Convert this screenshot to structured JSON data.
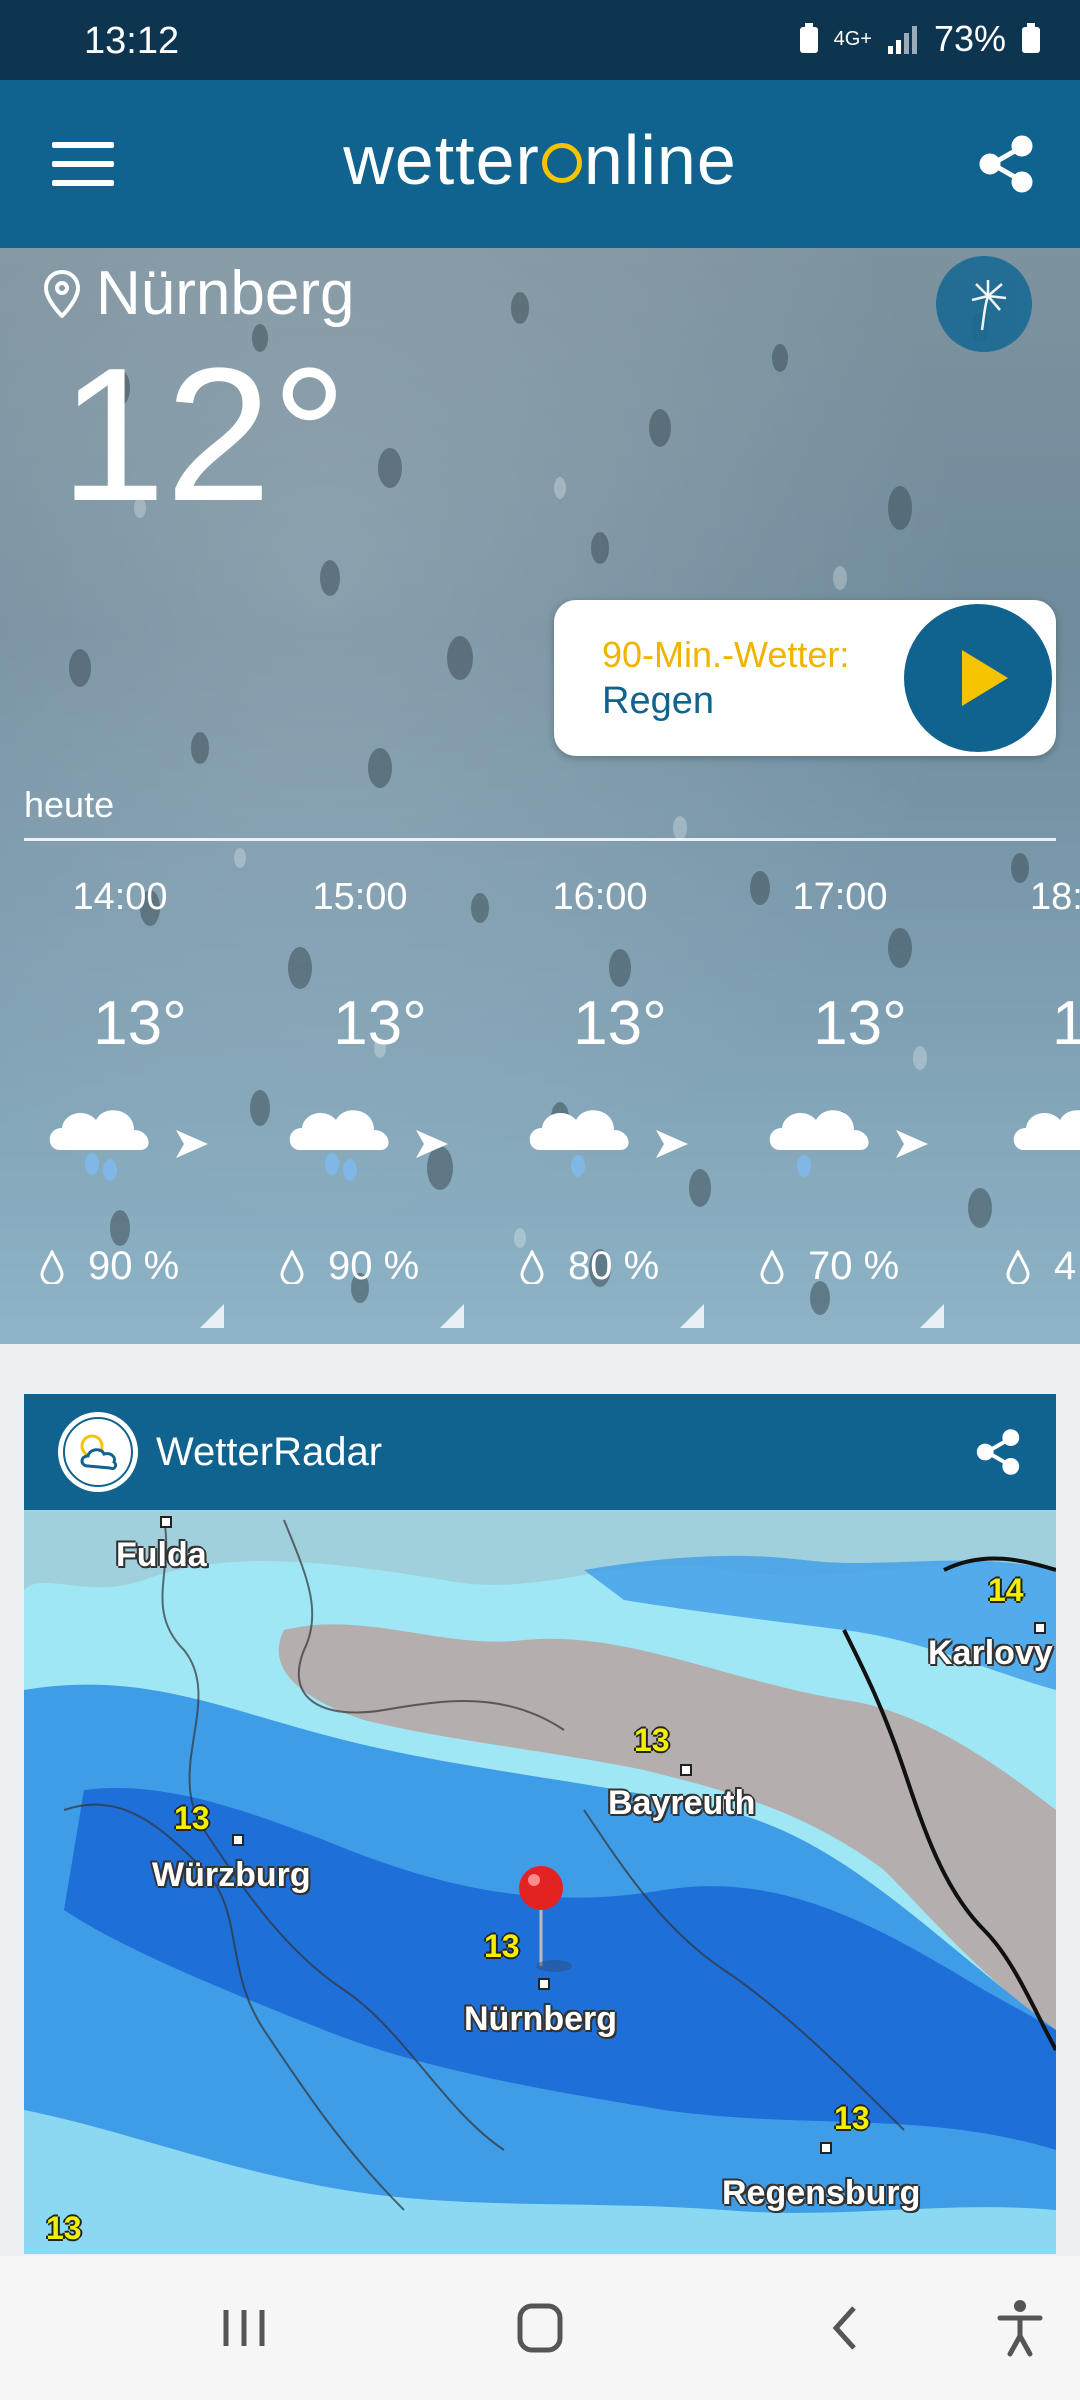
{
  "status": {
    "time": "13:12",
    "network": "4G+",
    "battery": "73%"
  },
  "header": {
    "logo_left": "wetter",
    "logo_right": "nline"
  },
  "location": {
    "name": "Nürnberg",
    "current_temp": "12°"
  },
  "nowcast": {
    "title": "90-Min.-Wetter:",
    "value": "Regen"
  },
  "forecast": {
    "day_label": "heute",
    "hours": [
      {
        "time": "14:00",
        "temp": "13°",
        "precip": "90 %",
        "icon": "cloud-heavy-rain-icon"
      },
      {
        "time": "15:00",
        "temp": "13°",
        "precip": "90 %",
        "icon": "cloud-heavy-rain-icon"
      },
      {
        "time": "16:00",
        "temp": "13°",
        "precip": "80 %",
        "icon": "cloud-rain-icon"
      },
      {
        "time": "17:00",
        "temp": "13°",
        "precip": "70 %",
        "icon": "cloud-rain-icon"
      },
      {
        "time": "18:",
        "temp": "1",
        "precip": "4",
        "icon": "cloud-icon"
      }
    ]
  },
  "radar": {
    "title": "WetterRadar",
    "cities": [
      "Fulda",
      "Karlovy",
      "Bayreuth",
      "Würzburg",
      "Nürnberg",
      "Regensburg"
    ],
    "temps": [
      "14",
      "13",
      "13",
      "13",
      "13",
      "13"
    ]
  },
  "colors": {
    "header": "#10628f",
    "statusbar": "#0e3550",
    "accent": "#f5c400"
  }
}
